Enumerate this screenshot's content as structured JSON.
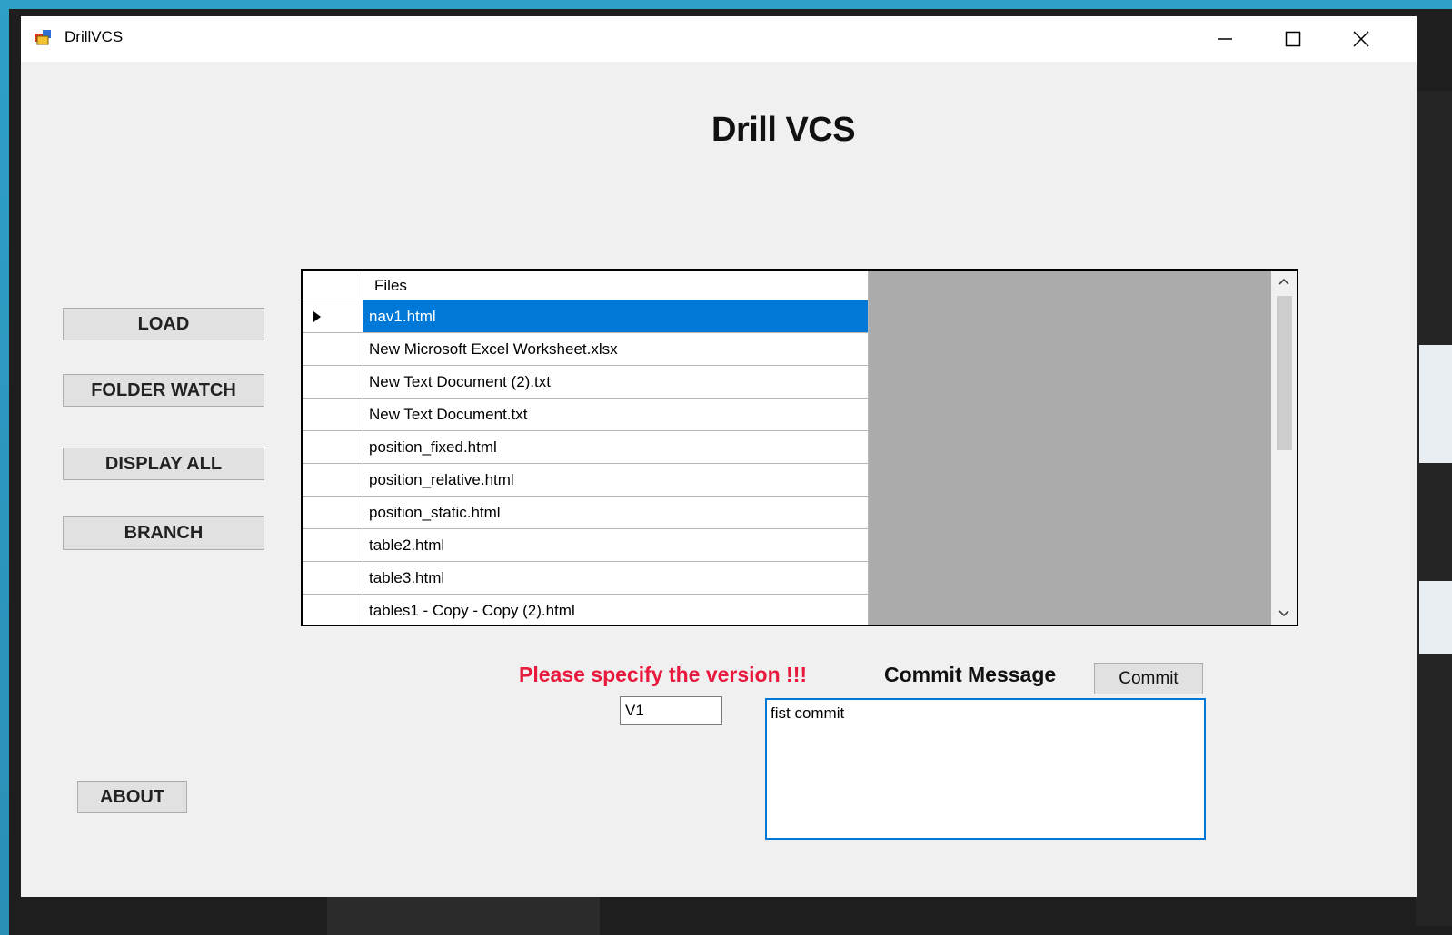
{
  "window": {
    "title": "DrillVCS"
  },
  "heading": "Drill VCS",
  "side_buttons": {
    "load": "LOAD",
    "folder_watch": "FOLDER WATCH",
    "display_all": "DISPLAY ALL",
    "branch": "BRANCH",
    "about": "ABOUT"
  },
  "grid": {
    "header": "Files",
    "selected_index": 0,
    "rows": [
      "nav1.html",
      "New Microsoft Excel Worksheet.xlsx",
      "New Text Document (2).txt",
      "New Text Document.txt",
      "position_fixed.html",
      "position_relative.html",
      "position_static.html",
      "table2.html",
      "table3.html",
      "tables1 - Copy - Copy (2).html"
    ]
  },
  "version": {
    "warning": "Please specify the version !!!",
    "value": "V1"
  },
  "commit": {
    "label": "Commit Message",
    "button": "Commit",
    "message": "fist commit"
  },
  "colors": {
    "selection": "#0078d7",
    "warning": "#e8193c",
    "grid_empty": "#ababab"
  },
  "icons": {
    "app": "app-window-icon",
    "minimize": "minimize-icon",
    "maximize": "maximize-icon",
    "close": "close-icon"
  }
}
